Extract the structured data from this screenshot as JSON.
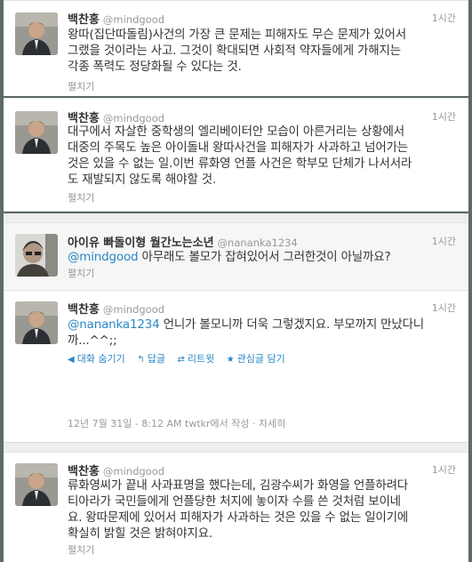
{
  "tweets": [
    {
      "name": "백찬홍",
      "handle": "@mindgood",
      "time": "1시간",
      "lines": [
        "왕따(집단따돌림)사건의 가장 큰 문제는 피해자도 무슨 문제가 있어서",
        "그랬을 것이라는 사고. 그것이 확대되면 사회적 약자들에게 가해지는",
        "각종 폭력도 정당화될 수 있다는 것."
      ],
      "expand": "펼치기"
    },
    {
      "name": "백찬홍",
      "handle": "@mindgood",
      "time": "1시간",
      "lines": [
        "대구에서 자살한 중학생의 엘리베이터안 모습이 아른거리는 상황에서",
        "대중의 주목도 높은 아이돌내 왕따사건을 피해자가 사과하고 넘어가는",
        "것은 있을 수 없는 일.이번 류화영 언플 사건은 학부모 단체가 나서서라",
        "도 재발되지 않도록 해야할 것."
      ],
      "expand": "펼치기"
    },
    {
      "name": "아이유 빠돌이형 월간노는소년",
      "handle": "@nananka1234",
      "time": "1시간",
      "mention": "@mindgood",
      "text": " 아무래도 볼모가 잡혀있어서 그러한것이 아닐까요?",
      "expand": "펼치기"
    },
    {
      "name": "백찬홍",
      "handle": "@mindgood",
      "time": "1시간",
      "mention": "@nananka1234",
      "text_line1": " 언니가 볼모니까 더욱 그렇겠지요. 부모까지 만났다니",
      "text_line2": "까...^^;;",
      "actions": [
        "대화 숨기기",
        "답글",
        "리트윗",
        "관심글 담기"
      ],
      "meta": "12년 7월 31일 - 8:12 AM twtkr에서 작성 · 자세히"
    },
    {
      "name": "백찬홍",
      "handle": "@mindgood",
      "time": "1시간",
      "lines": [
        "류화영씨가 끝내 사과표명을 했다는데, 김광수씨가 화영을 언플하려다",
        "티아라가 국민들에게 언플당한 처지에 놓이자 수를 쓴 것처럼 보이네",
        "요. 왕따문제에 있어서 피해자가 사과하는 것은 있을 수 없는 일이기에",
        "확실히 밝힐 것은 밝혀야지요."
      ],
      "expand": "펼치기"
    }
  ],
  "icons": {
    "hide": "arrow-icon",
    "reply": "reply-icon",
    "retweet": "retweet-icon",
    "favorite": "star-icon"
  }
}
